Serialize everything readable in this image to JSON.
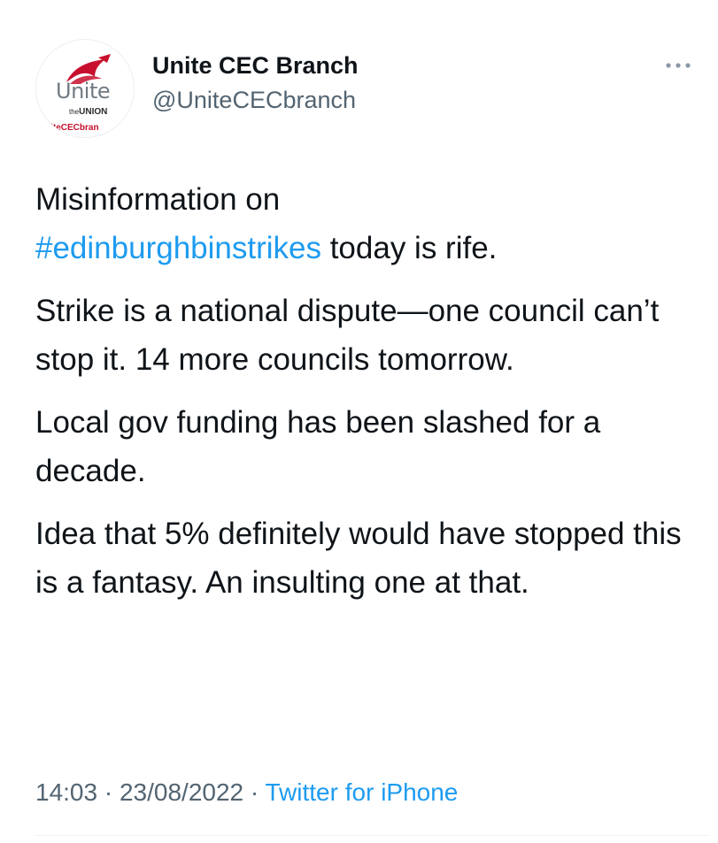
{
  "colors": {
    "text": "#0f1419",
    "secondary": "#536471",
    "link": "#1d9bf0",
    "logo_red": "#c8102e",
    "logo_grey": "#707a83"
  },
  "avatar": {
    "logo_word": "Unite",
    "logo_sub_prefix": "the",
    "logo_sub": "UNION",
    "logo_handle": "niteCECbran"
  },
  "author": {
    "display_name": "Unite CEC Branch",
    "handle": "@UniteCECbranch"
  },
  "icons": {
    "more": "more-horizontal-icon"
  },
  "tweet": {
    "line1": "Misinformation on",
    "hashtag": "#edinburghbinstrikes",
    "line2_rest": " today is rife.",
    "para2": "Strike is a national dispute—one council can’t stop it. 14 more councils tomorrow.",
    "para3": "Local gov funding has been slashed for a decade.",
    "para4": "Idea that 5% definitely would have stopped this is a fantasy. An insulting one at that."
  },
  "meta": {
    "time": "14:03",
    "sep1": " · ",
    "date": "23/08/2022",
    "sep2": " · ",
    "source": "Twitter for iPhone"
  }
}
